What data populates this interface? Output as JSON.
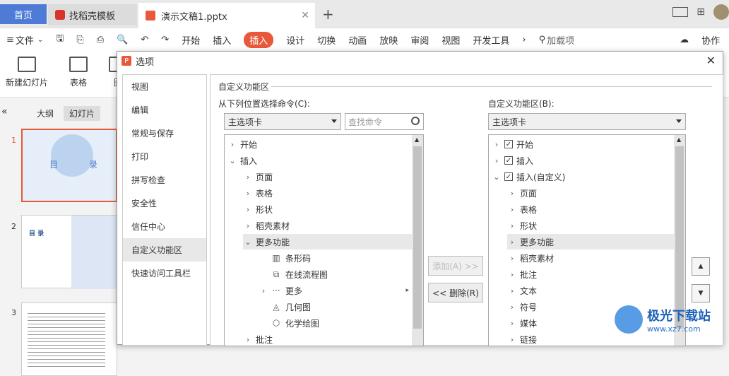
{
  "tabs": {
    "home": "首页",
    "template": "找稻壳模板",
    "doc": "演示文稿1.pptx",
    "plus": "+"
  },
  "menubar": {
    "file": "文件",
    "items": [
      "开始",
      "插入",
      "设计",
      "切换",
      "动画",
      "放映",
      "审阅",
      "视图",
      "开发工具"
    ],
    "active": "插入",
    "search": "加载项",
    "collab": "协作"
  },
  "ribbon": {
    "new_slide": "新建幻灯片",
    "table": "表格",
    "img": "图"
  },
  "leftpanel": {
    "outline": "大纲",
    "slides": "幻灯片",
    "nums": [
      "1",
      "2",
      "3"
    ],
    "s1_title": "目",
    "s1_title2": "录",
    "s2_title": "目 录"
  },
  "dialog": {
    "title": "选项",
    "nav": [
      "视图",
      "编辑",
      "常规与保存",
      "打印",
      "拼写检查",
      "安全性",
      "信任中心",
      "自定义功能区",
      "快速访问工具栏"
    ],
    "nav_selected": "自定义功能区",
    "section": "自定义功能区",
    "from_label": "从下列位置选择命令(C):",
    "from_value": "主选项卡",
    "search_placeholder": "查找命令",
    "to_label": "自定义功能区(B):",
    "to_value": "主选项卡",
    "left_tree": [
      {
        "text": "开始",
        "level": 0,
        "chev": "›"
      },
      {
        "text": "插入",
        "level": 0,
        "chev": "⌄"
      },
      {
        "text": "页面",
        "level": 1,
        "chev": "›"
      },
      {
        "text": "表格",
        "level": 1,
        "chev": "›"
      },
      {
        "text": "形状",
        "level": 1,
        "chev": "›"
      },
      {
        "text": "稻壳素材",
        "level": 1,
        "chev": "›"
      },
      {
        "text": "更多功能",
        "level": 1,
        "chev": "⌄",
        "hl": true
      },
      {
        "text": "条形码",
        "level": 2,
        "icon": "▥"
      },
      {
        "text": "在线流程图",
        "level": 2,
        "icon": "⧉"
      },
      {
        "text": "更多",
        "level": 2,
        "icon": "···",
        "chev": "›",
        "more": true
      },
      {
        "text": "几何图",
        "level": 2,
        "icon": "◬"
      },
      {
        "text": "化学绘图",
        "level": 2,
        "icon": "⬡"
      },
      {
        "text": "批注",
        "level": 1,
        "chev": "›"
      }
    ],
    "right_tree": [
      {
        "text": "开始",
        "level": 0,
        "chev": "›",
        "check": true
      },
      {
        "text": "插入",
        "level": 0,
        "chev": "›",
        "check": true
      },
      {
        "text": "插入(自定义)",
        "level": 0,
        "chev": "⌄",
        "check": true
      },
      {
        "text": "页面",
        "level": 1,
        "chev": "›"
      },
      {
        "text": "表格",
        "level": 1,
        "chev": "›"
      },
      {
        "text": "形状",
        "level": 1,
        "chev": "›"
      },
      {
        "text": "更多功能",
        "level": 1,
        "chev": "›",
        "hl": true
      },
      {
        "text": "稻壳素材",
        "level": 1,
        "chev": "›"
      },
      {
        "text": "批注",
        "level": 1,
        "chev": "›"
      },
      {
        "text": "文本",
        "level": 1,
        "chev": "›"
      },
      {
        "text": "符号",
        "level": 1,
        "chev": "›"
      },
      {
        "text": "媒体",
        "level": 1,
        "chev": "›"
      },
      {
        "text": "链接",
        "level": 1,
        "chev": "›"
      }
    ],
    "add_btn": "添加(A) >>",
    "remove_btn": "<< 删除(R)",
    "up": "▲",
    "down": "▼"
  },
  "watermark": {
    "name": "极光下载站",
    "url": "www.xz7.com"
  }
}
